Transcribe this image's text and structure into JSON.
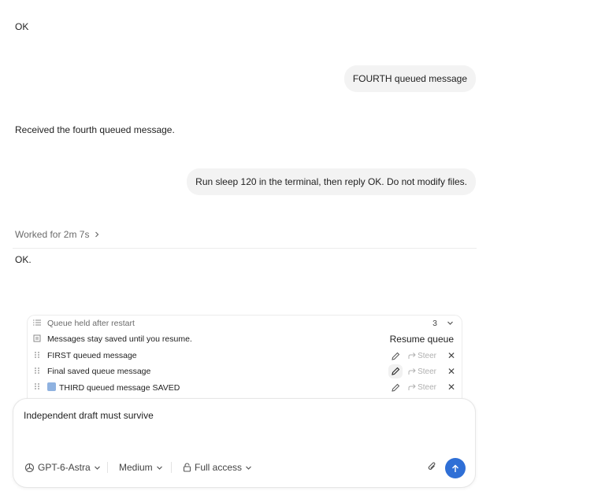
{
  "conversation": {
    "assistant_1": "OK",
    "user_1": "FOURTH queued message",
    "assistant_2": "Received the fourth queued message.",
    "user_2": "Run sleep 120 in the terminal, then reply OK. Do not modify files.",
    "worked_label": "Worked for 2m 7s",
    "assistant_3": "OK."
  },
  "queue": {
    "header_label": "Queue held after restart",
    "count": "3",
    "notice": "Messages stay saved until you resume.",
    "resume_label": "Resume queue",
    "steer_label": "Steer",
    "items": [
      {
        "label": "FIRST queued message",
        "has_image": false
      },
      {
        "label": "Final saved queue message",
        "has_image": false
      },
      {
        "label": "THIRD queued message SAVED",
        "has_image": true
      }
    ]
  },
  "composer": {
    "draft": "Independent draft must survive",
    "model": "GPT-6-Astra",
    "effort": "Medium",
    "access": "Full access"
  },
  "colors": {
    "send_button": "#2f6fd6",
    "bubble": "#f3f3f3",
    "thumbnail": "#8fb2e0"
  }
}
